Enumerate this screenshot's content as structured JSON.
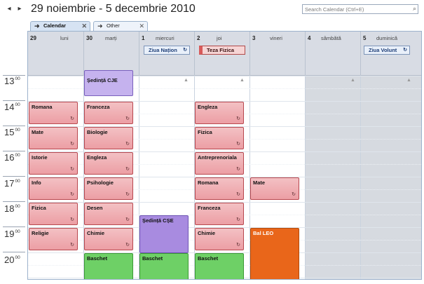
{
  "header": {
    "prev_label": "◂",
    "next_label": "▸",
    "date_range": "29 noiembrie - 5 decembrie 2010",
    "search_placeholder": "Search Calendar (Ctrl+E)"
  },
  "tabs": [
    {
      "label": "Calendar",
      "close": "✕"
    },
    {
      "label": "Other",
      "close": "✕"
    }
  ],
  "days": [
    {
      "num": "29",
      "name": "luni"
    },
    {
      "num": "30",
      "name": "marți"
    },
    {
      "num": "1",
      "name": "miercuri"
    },
    {
      "num": "2",
      "name": "joi"
    },
    {
      "num": "3",
      "name": "vineri"
    },
    {
      "num": "4",
      "name": "sâmbătă"
    },
    {
      "num": "5",
      "name": "duminică"
    }
  ],
  "allday": {
    "wed": "Ziua Națion",
    "thu": "Teza Fizica",
    "sun": "Ziua Volunt"
  },
  "times": {
    "t13": "13",
    "t14": "14",
    "t15": "15",
    "t16": "16",
    "t17": "17",
    "t18": "18",
    "t19": "19",
    "t20": "20",
    "sup": "00"
  },
  "events": {
    "mon": [
      "Romana",
      "Mate",
      "Istorie",
      "Info",
      "Fizica",
      "Religie"
    ],
    "tue": [
      "Ședință CJE",
      "Franceza",
      "Biologie",
      "Engleza",
      "Psihologie",
      "Desen",
      "Chimie",
      "Baschet"
    ],
    "wed": [
      "Ședință CȘE",
      "Baschet"
    ],
    "thu": [
      "Engleza",
      "Fizica",
      "Antreprenoriala",
      "Romana",
      "Franceza",
      "Chimie",
      "Baschet"
    ],
    "fri": [
      "Mate",
      "Bal LEO"
    ]
  },
  "colors": {
    "red": "#ec9ea4",
    "purple": "#a88be0",
    "green": "#6ed066",
    "orange": "#e9661a",
    "weekend": "#d6dae0"
  },
  "icons": {
    "sync": "recurring-icon",
    "nav_prev": "arrow-left-icon",
    "nav_next": "arrow-right-icon",
    "tab": "tab-arrow-icon",
    "search": "search-icon"
  }
}
